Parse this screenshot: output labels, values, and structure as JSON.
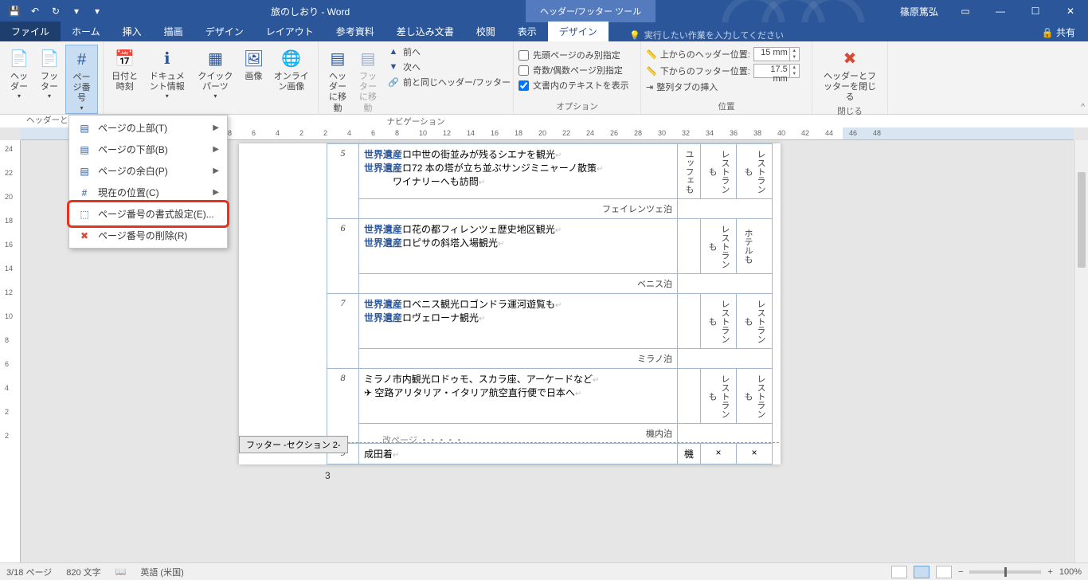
{
  "title": "旅のしおり - Word",
  "tool_tab": "ヘッダー/フッター ツール",
  "user": "篠原篤弘",
  "tabs": {
    "file": "ファイル",
    "home": "ホーム",
    "insert": "挿入",
    "draw": "描画",
    "design": "デザイン",
    "layout": "レイアウト",
    "ref": "参考資料",
    "mail": "差し込み文書",
    "review": "校閲",
    "view": "表示",
    "tool_design": "デザイン"
  },
  "tell": "実行したい作業を入力してください",
  "share": "共有",
  "ribbon": {
    "hf": {
      "header": "ヘッダー",
      "footer": "フッター",
      "page_num": "ページ番号",
      "label": "ヘッダーとフ"
    },
    "ins": {
      "datetime": "日付と時刻",
      "docinfo": "ドキュメント情報",
      "quick": "クイック パーツ",
      "image": "画像",
      "online": "オンライン画像",
      "label": ""
    },
    "nav": {
      "goto_h": "ヘッダーに移動",
      "goto_f": "フッターに移動",
      "prev": "前へ",
      "next": "次へ",
      "same": "前と同じヘッダー/フッター",
      "label": "ナビゲーション"
    },
    "opt": {
      "first": "先頭ページのみ別指定",
      "odd": "奇数/偶数ページ別指定",
      "show": "文書内のテキストを表示",
      "label": "オプション"
    },
    "pos": {
      "top": "上からのヘッダー位置:",
      "bot": "下からのフッター位置:",
      "tab": "整列タブの挿入",
      "top_v": "15 mm",
      "bot_v": "17.5 mm",
      "label": "位置"
    },
    "close": {
      "btn": "ヘッダーとフッターを閉じる",
      "label": "閉じる"
    }
  },
  "menu": {
    "top": "ページの上部(T)",
    "bottom": "ページの下部(B)",
    "margin": "ページの余白(P)",
    "current": "現在の位置(C)",
    "format": "ページ番号の書式設定(E)...",
    "remove": "ページ番号の削除(R)"
  },
  "ruler_h": [
    8,
    6,
    4,
    2,
    2,
    4,
    6,
    8,
    10,
    12,
    14,
    16,
    18,
    20,
    22,
    24,
    26,
    28,
    30,
    32,
    34,
    36,
    38,
    40,
    42,
    44,
    46,
    48
  ],
  "ruler_v": [
    24,
    22,
    20,
    18,
    16,
    14,
    12,
    10,
    8,
    6,
    4,
    2,
    2
  ],
  "doc": {
    "wh": "世界遺産",
    "r5": {
      "n": "5",
      "a": "中世の街並みが残るシエナを観光",
      "b": "72 本の塔が立ち並ぶサンジミニャーノ散策",
      "c": "ワイナリーへも訪問",
      "d": "フェイレンツェ泊",
      "e": "ユッフェも",
      "f": "レストランも",
      "g": "レストランも"
    },
    "r6": {
      "n": "6",
      "a": "花の都フィレンツェ歴史地区観光",
      "b": "ピサの斜塔入場観光",
      "d": "ベニス泊",
      "f": "レストランも",
      "g": "ホテルも"
    },
    "r7": {
      "n": "7",
      "a": "ベニス観光ロゴンドラ運河遊覧も",
      "b": "ヴェローナ観光",
      "d": "ミラノ泊",
      "f": "レストランも",
      "g": "レストランも"
    },
    "r8": {
      "n": "8",
      "a": "ミラノ市内観光ロドゥモ、スカラ座、アーケードなど",
      "b": "✈ 空路アリタリア・イタリア航空直行便で日本へ",
      "d": "機内泊",
      "f": "レストランも",
      "g": "レストランも"
    },
    "r9": {
      "n": "9",
      "a": "成田着",
      "e": "機",
      "f": "×",
      "g": "×"
    },
    "pagebreak": "改ページ",
    "footer_tag": "フッター -セクション 2-",
    "page_num": "3"
  },
  "status": {
    "page": "3/18 ページ",
    "words": "820 文字",
    "lang": "英語 (米国)",
    "zoom": "100%"
  }
}
